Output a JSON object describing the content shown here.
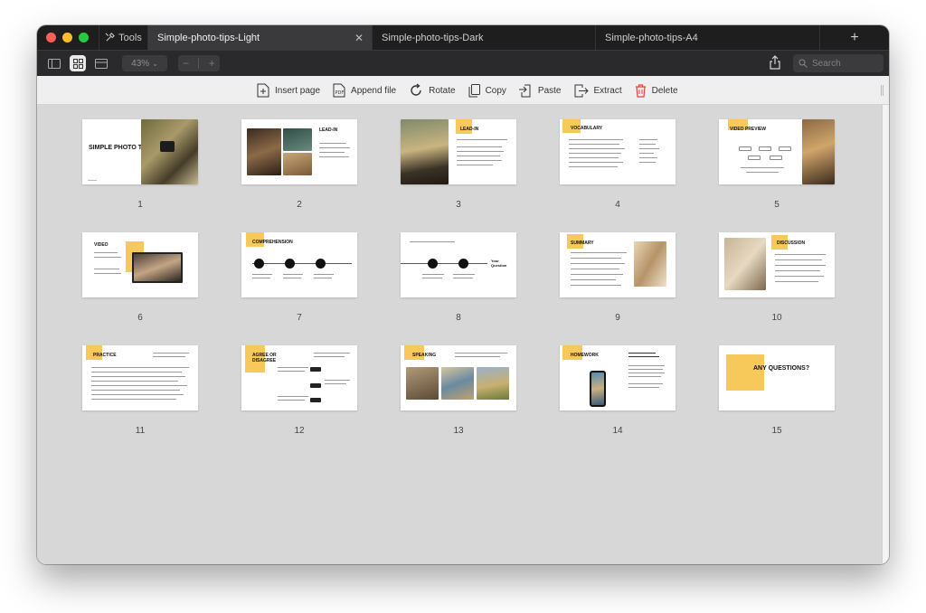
{
  "window": {
    "tools_label": "Tools",
    "tabs": [
      {
        "label": "Simple-photo-tips-Light",
        "active": true
      },
      {
        "label": "Simple-photo-tips-Dark",
        "active": false
      },
      {
        "label": "Simple-photo-tips-A4",
        "active": false
      }
    ],
    "new_tab_label": "+"
  },
  "toolbar": {
    "zoom": "43%",
    "zoom_minus": "−",
    "zoom_plus": "+",
    "search_placeholder": "Search",
    "view_icons": [
      "sidebar-icon",
      "grid-view-icon",
      "single-page-icon"
    ],
    "share_icon": "share-icon"
  },
  "actions": [
    {
      "label": "Insert page",
      "icon": "insert-page-icon"
    },
    {
      "label": "Append file",
      "icon": "append-file-icon"
    },
    {
      "label": "Rotate",
      "icon": "rotate-icon"
    },
    {
      "label": "Copy",
      "icon": "copy-icon"
    },
    {
      "label": "Paste",
      "icon": "paste-icon"
    },
    {
      "label": "Extract",
      "icon": "extract-icon"
    },
    {
      "label": "Delete",
      "icon": "trash-icon",
      "color": "#e0413a"
    }
  ],
  "colors": {
    "accent_yellow": "#f7c85a",
    "delete_red": "#e0413a"
  },
  "pages": [
    {
      "num": "1",
      "title": "SIMPLE PHOTO TIPS"
    },
    {
      "num": "2",
      "title": "LEAD-IN"
    },
    {
      "num": "3",
      "title": "LEAD-IN"
    },
    {
      "num": "4",
      "title": "VOCABULARY"
    },
    {
      "num": "5",
      "title": "VIDEO PREVIEW"
    },
    {
      "num": "6",
      "title": "VIDEO"
    },
    {
      "num": "7",
      "title": "COMPREHENSION"
    },
    {
      "num": "8",
      "title": "Your Question"
    },
    {
      "num": "9",
      "title": "SUMMARY"
    },
    {
      "num": "10",
      "title": "DISCUSSION"
    },
    {
      "num": "11",
      "title": "PRACTICE"
    },
    {
      "num": "12",
      "title": "AGREE OR DISAGREE"
    },
    {
      "num": "13",
      "title": "SPEAKING"
    },
    {
      "num": "14",
      "title": "HOMEWORK"
    },
    {
      "num": "15",
      "title": "ANY QUESTIONS?"
    }
  ]
}
